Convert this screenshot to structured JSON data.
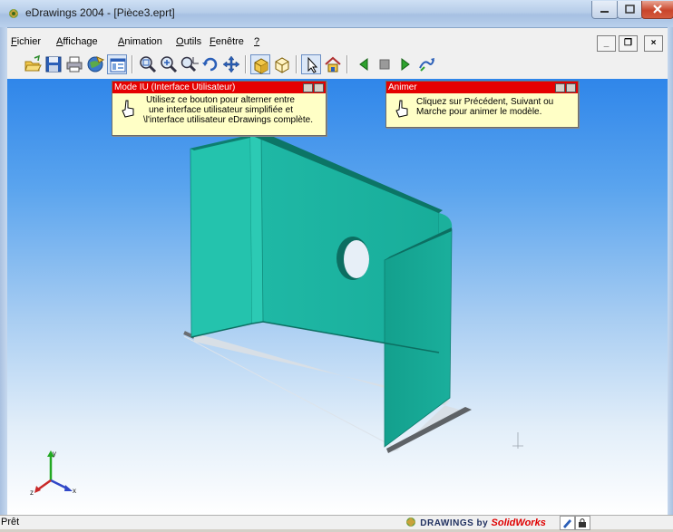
{
  "window": {
    "title": "eDrawings 2004 - [Pièce3.eprt]"
  },
  "menu": {
    "items": [
      {
        "u": "F",
        "rest": "ichier"
      },
      {
        "u": "A",
        "rest": "ffichage"
      },
      {
        "u": "A",
        "rest": "nimation"
      },
      {
        "u": "O",
        "rest": "utils"
      },
      {
        "u": "F",
        "rest": "enêtre"
      },
      {
        "u": "?",
        "rest": ""
      }
    ],
    "mdi": {
      "minimize": "_",
      "restore": "❐",
      "close": "×"
    }
  },
  "toolbar": {
    "buttons": [
      "open-icon",
      "save-icon",
      "print-icon",
      "send-icon",
      "ui-mode-icon",
      "zoom-fit-icon",
      "zoom-in-icon",
      "zoom-area-icon",
      "rotate-icon",
      "pan-icon",
      "shaded-icon",
      "wireframe-icon",
      "select-icon",
      "home-view-icon",
      "previous-icon",
      "stop-icon",
      "next-icon",
      "play-icon"
    ]
  },
  "tooltips": {
    "ui_mode": {
      "title": "Mode IU (Interface Utilisateur)",
      "lines": [
        "Utilisez ce bouton pour alterner entre",
        "une interface utilisateur simplifiée et",
        "\\l'interface utilisateur eDrawings complète."
      ]
    },
    "animate": {
      "title": "Animer",
      "lines": [
        "Cliquez sur Précédent, Suivant ou",
        "Marche pour animer le modèle."
      ]
    }
  },
  "triad": {
    "x": "x",
    "y": "y",
    "z": "z"
  },
  "statusbar": {
    "text": "Prêt",
    "brand_a": "DRAWINGS by ",
    "brand_b": "SolidWorks"
  },
  "colors": {
    "part": "#1fb5a2",
    "part_dark": "#0f8f7e",
    "tooltip_header": "#e50000",
    "tooltip_bg": "#ffffc6"
  }
}
